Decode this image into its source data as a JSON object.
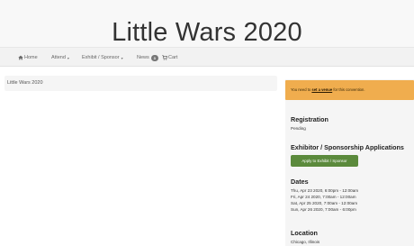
{
  "site": {
    "title": "Little Wars 2020"
  },
  "nav": {
    "home": "Home",
    "attend": "Attend",
    "exhibit": "Exhibit / Sponsor",
    "news": "News",
    "news_count": "3",
    "cart": "Cart"
  },
  "breadcrumb": {
    "current": "Little Wars 2020"
  },
  "alert": {
    "prefix": "You need to ",
    "link": "set a venue",
    "suffix": " for this convention.",
    "color": "#f0ad4e"
  },
  "sidebar": {
    "registration": {
      "heading": "Registration",
      "status": "Pending"
    },
    "exhibitor": {
      "heading": "Exhibitor / Sponsorship Applications",
      "button": "Apply to Exhibit / Sponsor"
    },
    "dates": {
      "heading": "Dates",
      "items": [
        "Thu, Apr 23 2020, 6:00pm - 12:00am",
        "Fri, Apr 24 2020, 7:00am - 12:00am",
        "Sat, Apr 25 2020, 7:00am - 12:00am",
        "Sun, Apr 26 2020, 7:00am - 6:00pm"
      ]
    },
    "location": {
      "heading": "Location",
      "value": "Chicago, Illinois"
    }
  },
  "colors": {
    "button": "#5b8a3c",
    "header_bg": "#f8f8f8",
    "sidebar_bg": "#f5f5f5"
  }
}
